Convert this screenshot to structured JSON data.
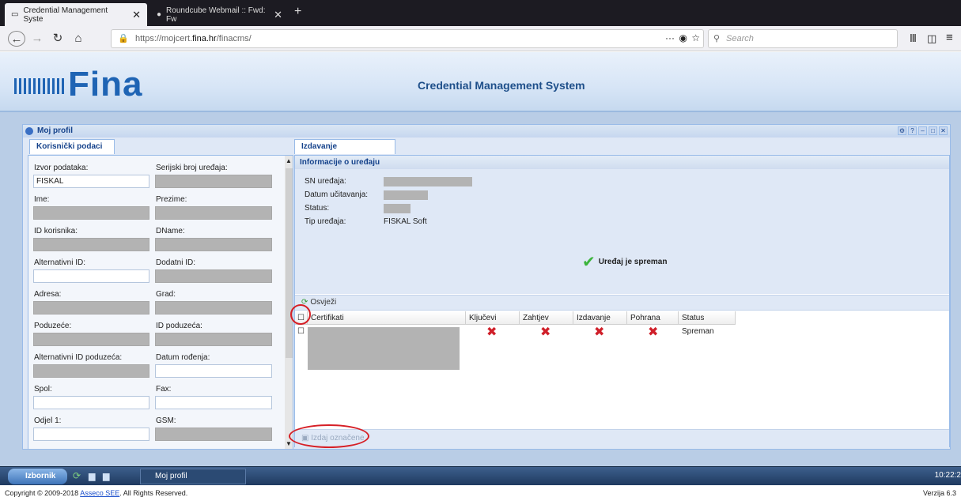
{
  "browser": {
    "tab1": "Credential Management Syste",
    "tab2": "Roundcube Webmail :: Fwd: Fw",
    "url_prefix": "https://mojcert.",
    "url_host": "fina.hr",
    "url_suffix": "/finacms/",
    "search_placeholder": "Search"
  },
  "header": {
    "logo": "Fina",
    "title": "Credential Management System"
  },
  "window": {
    "title": "Moj profil"
  },
  "left": {
    "tab": "Korisnički podaci",
    "fields": {
      "izvor_label": "Izvor podataka:",
      "izvor_value": "FISKAL",
      "serijski_label": "Serijski broj uređaja:",
      "ime_label": "Ime:",
      "prezime_label": "Prezime:",
      "idk_label": "ID korisnika:",
      "dname_label": "DName:",
      "altid_label": "Alternativni ID:",
      "dodid_label": "Dodatni ID:",
      "adresa_label": "Adresa:",
      "grad_label": "Grad:",
      "poduzece_label": "Poduzeće:",
      "idpod_label": "ID poduzeća:",
      "altidpod_label": "Alternativni ID poduzeća:",
      "datum_label": "Datum rođenja:",
      "spol_label": "Spol:",
      "fax_label": "Fax:",
      "odjel_label": "Odjel 1:",
      "gsm_label": "GSM:"
    }
  },
  "right": {
    "tab": "Izdavanje",
    "info_title": "Informacije o uređaju",
    "sn": "SN uređaja:",
    "datum": "Datum učitavanja:",
    "status": "Status:",
    "tip": "Tip uređaja:",
    "tip_value": "FISKAL Soft",
    "ready": "Uređaj je spreman",
    "refresh": "Osvježi",
    "cols": [
      "Certifikati",
      "Ključevi",
      "Zahtjev",
      "Izdavanje",
      "Pohrana",
      "Status"
    ],
    "row_status": "Spreman",
    "issue_btn": "Izdaj označene"
  },
  "taskbar": {
    "start": "Izbornik",
    "window": "Moj profil",
    "clock": "10:22:2"
  },
  "footer": {
    "copyright": "Copyright © 2009-2018 ",
    "company": "Asseco SEE",
    "rights": ". All Rights Reserved.",
    "version": "Verzija 6.3"
  }
}
